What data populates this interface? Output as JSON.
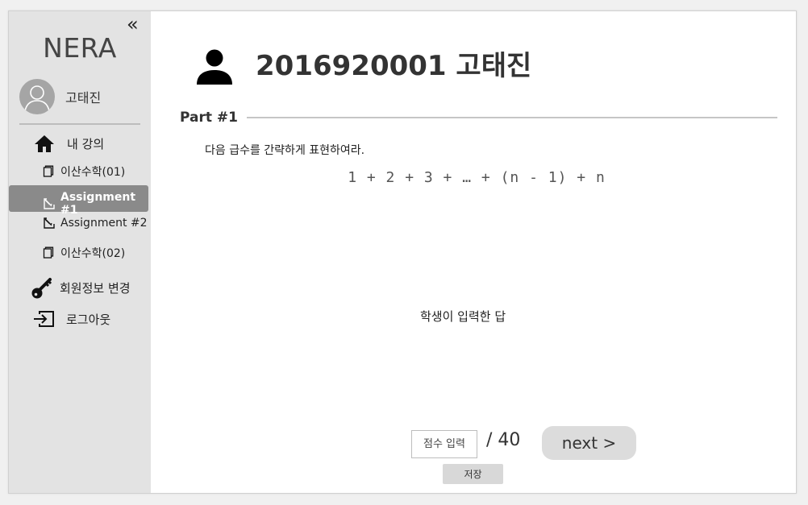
{
  "sidebar": {
    "collapse_icon": "double-chevron-left-icon",
    "logo": "NERA",
    "user_name": "고태진",
    "items": [
      {
        "label": "내 강의",
        "icon": "home-icon"
      },
      {
        "label": "이산수학(01)",
        "icon": "notebook-icon"
      },
      {
        "label": "Assignment #1",
        "icon": "edit-icon",
        "active": true
      },
      {
        "label": "Assignment #2",
        "icon": "edit-icon"
      },
      {
        "label": "이산수학(02)",
        "icon": "notebook-icon"
      },
      {
        "label": "회원정보 변경",
        "icon": "key-icon"
      },
      {
        "label": "로그아웃",
        "icon": "logout-icon"
      }
    ]
  },
  "main": {
    "title": "2016920001 고태진",
    "part_label": "Part #1",
    "prompt": "다음 급수를 간략하게 표현하여라.",
    "formula": "1 + 2 + 3 + … + (n - 1) + n",
    "answer_text": "학생이 입력한 답",
    "score_placeholder": "점수 입력",
    "score_total": "/ 40",
    "next_label": "next >",
    "save_label": "저장"
  },
  "colors": {
    "sidebar_bg": "#e3e3e3",
    "active_item_bg": "#8a8a8a",
    "button_bg": "#dcdcdc"
  }
}
